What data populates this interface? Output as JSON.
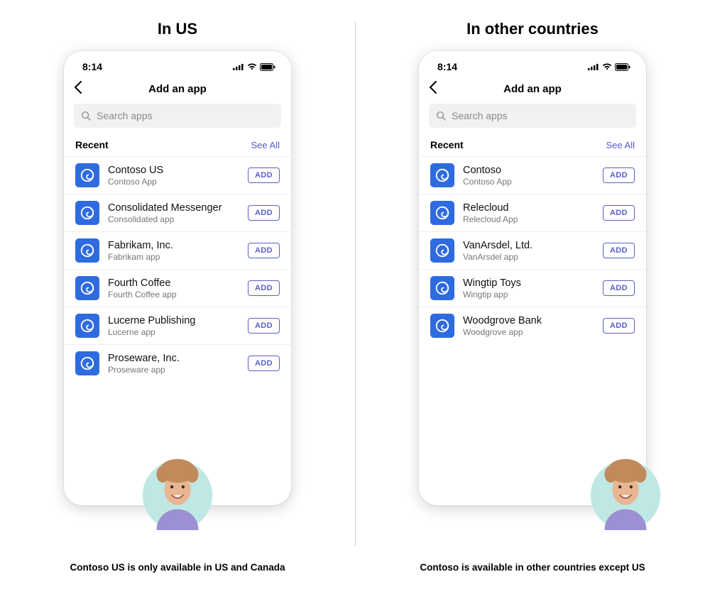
{
  "headings": {
    "left": "In US",
    "right": "In other countries"
  },
  "captions": {
    "left": "Contoso US is only available in US and Canada",
    "right": "Contoso is available in other countries except US"
  },
  "phone": {
    "time": "8:14",
    "title": "Add an app",
    "search_placeholder": "Search apps",
    "section_label": "Recent",
    "see_all": "See All",
    "add_label": "ADD"
  },
  "left_apps": [
    {
      "name": "Contoso US",
      "sub": "Contoso App"
    },
    {
      "name": "Consolidated Messenger",
      "sub": "Consolidated app"
    },
    {
      "name": "Fabrikam, Inc.",
      "sub": "Fabrikam app"
    },
    {
      "name": "Fourth Coffee",
      "sub": "Fourth Coffee app"
    },
    {
      "name": "Lucerne Publishing",
      "sub": "Lucerne app"
    },
    {
      "name": "Proseware, Inc.",
      "sub": "Proseware app"
    }
  ],
  "right_apps": [
    {
      "name": "Contoso",
      "sub": "Contoso App"
    },
    {
      "name": "Relecloud",
      "sub": "Relecloud App"
    },
    {
      "name": "VanArsdel, Ltd.",
      "sub": "VanArsdel app"
    },
    {
      "name": "Wingtip Toys",
      "sub": "Wingtip app"
    },
    {
      "name": "Woodgrove Bank",
      "sub": "Woodgrove  app"
    }
  ],
  "colors": {
    "accent": "#5b5fc7",
    "icon_bg": "#2f6be0"
  }
}
